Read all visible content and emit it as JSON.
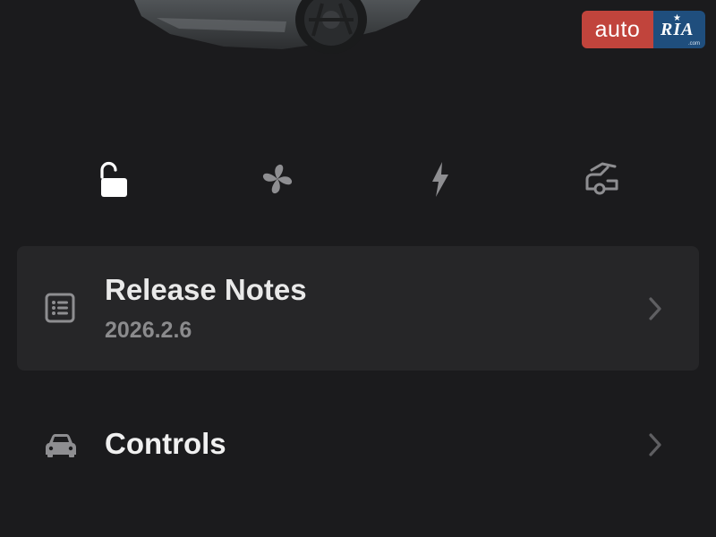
{
  "watermark": {
    "left_text": "auto",
    "right_text": "RIA",
    "domain": ".com"
  },
  "quick_actions": [
    {
      "name": "unlock",
      "icon": "unlock-icon",
      "active": true
    },
    {
      "name": "climate",
      "icon": "fan-icon",
      "active": false
    },
    {
      "name": "charging",
      "icon": "lightning-icon",
      "active": false
    },
    {
      "name": "trunk",
      "icon": "trunk-open-icon",
      "active": false
    }
  ],
  "release_notes": {
    "title": "Release Notes",
    "version": "2026.2.6",
    "icon": "list-icon"
  },
  "controls": {
    "title": "Controls",
    "icon": "car-icon"
  },
  "colors": {
    "background": "#1b1b1d",
    "card": "#262628",
    "active_icon": "#ffffff",
    "inactive_icon": "#8e8e91"
  }
}
